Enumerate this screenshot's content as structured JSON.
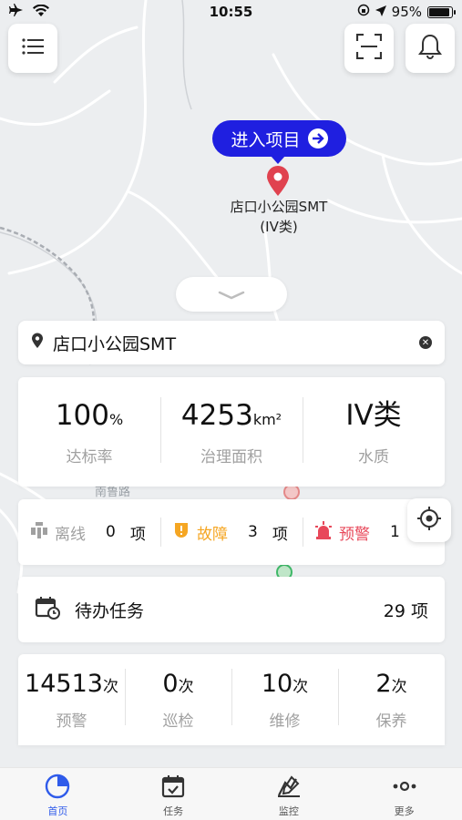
{
  "status_bar": {
    "time": "10:55",
    "battery": "95%",
    "battery_level": 0.95
  },
  "marker": {
    "enter_label": "进入项目",
    "name_line1": "店口小公园SMT",
    "name_line2": "(IV类)"
  },
  "search": {
    "value": "店口小公园SMT"
  },
  "stats": [
    {
      "value": "100",
      "unit": "%",
      "label": "达标率"
    },
    {
      "value": "4253",
      "unit": "km²",
      "label": "治理面积"
    },
    {
      "value": "IV类",
      "unit": "",
      "label": "水质"
    }
  ],
  "device_status": [
    {
      "label": "离线",
      "count": "0",
      "unit": "项",
      "color": "#a0a0a0"
    },
    {
      "label": "故障",
      "count": "3",
      "unit": "项",
      "color": "#f5a623"
    },
    {
      "label": "预警",
      "count": "1",
      "unit": "",
      "color": "#e8485a"
    }
  ],
  "tasks": {
    "title": "待办任务",
    "count": "29 项"
  },
  "counts": [
    {
      "value": "14513",
      "unit": "次",
      "label": "预警"
    },
    {
      "value": "0",
      "unit": "次",
      "label": "巡检"
    },
    {
      "value": "10",
      "unit": "次",
      "label": "维修"
    },
    {
      "value": "2",
      "unit": "次",
      "label": "保养"
    }
  ],
  "map_label": "南鲁路",
  "tab_bar": {
    "items": [
      {
        "label": "首页",
        "icon": "home-pie-icon",
        "active": true
      },
      {
        "label": "任务",
        "icon": "calendar-check-icon",
        "active": false
      },
      {
        "label": "监控",
        "icon": "monitor-edit-icon",
        "active": false
      },
      {
        "label": "更多",
        "icon": "more-dots-icon",
        "active": false
      }
    ]
  },
  "colors": {
    "accent": "#1f1fe0",
    "active_tab": "#2f5bea",
    "warning": "#f5a623",
    "alert": "#e8485a",
    "pin": "#e0424f"
  }
}
